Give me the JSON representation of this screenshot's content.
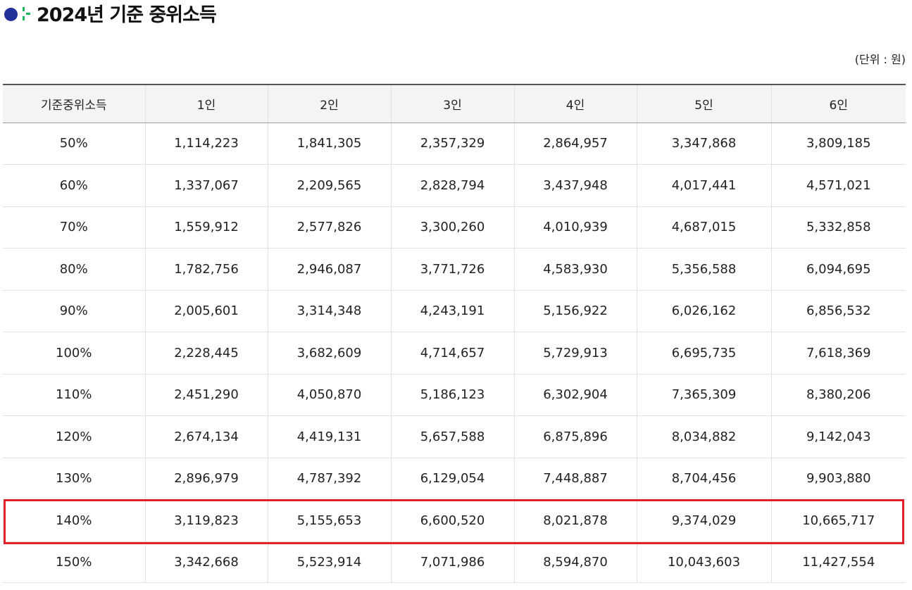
{
  "title": "2024년 기준 중위소득",
  "unit": "(단위 : 원)",
  "table": {
    "headers": [
      "기준중위소득",
      "1인",
      "2인",
      "3인",
      "4인",
      "5인",
      "6인"
    ],
    "rows": [
      [
        "50%",
        "1,114,223",
        "1,841,305",
        "2,357,329",
        "2,864,957",
        "3,347,868",
        "3,809,185"
      ],
      [
        "60%",
        "1,337,067",
        "2,209,565",
        "2,828,794",
        "3,437,948",
        "4,017,441",
        "4,571,021"
      ],
      [
        "70%",
        "1,559,912",
        "2,577,826",
        "3,300,260",
        "4,010,939",
        "4,687,015",
        "5,332,858"
      ],
      [
        "80%",
        "1,782,756",
        "2,946,087",
        "3,771,726",
        "4,583,930",
        "5,356,588",
        "6,094,695"
      ],
      [
        "90%",
        "2,005,601",
        "3,314,348",
        "4,243,191",
        "5,156,922",
        "6,026,162",
        "6,856,532"
      ],
      [
        "100%",
        "2,228,445",
        "3,682,609",
        "4,714,657",
        "5,729,913",
        "6,695,735",
        "7,618,369"
      ],
      [
        "110%",
        "2,451,290",
        "4,050,870",
        "5,186,123",
        "6,302,904",
        "7,365,309",
        "8,380,206"
      ],
      [
        "120%",
        "2,674,134",
        "4,419,131",
        "5,657,588",
        "6,875,896",
        "8,034,882",
        "9,142,043"
      ],
      [
        "130%",
        "2,896,979",
        "4,787,392",
        "6,129,054",
        "7,448,887",
        "8,704,456",
        "9,903,880"
      ],
      [
        "140%",
        "3,119,823",
        "5,155,653",
        "6,600,520",
        "8,021,878",
        "9,374,029",
        "10,665,717"
      ],
      [
        "150%",
        "3,342,668",
        "5,523,914",
        "7,071,986",
        "8,594,870",
        "10,043,603",
        "11,427,554"
      ]
    ],
    "highlighted_row": "140%"
  },
  "colors": {
    "brand_dot": "#22309a",
    "brand_plus": "#19b75a",
    "highlight_border": "#e0202a",
    "header_bg": "#f4f4f4"
  }
}
